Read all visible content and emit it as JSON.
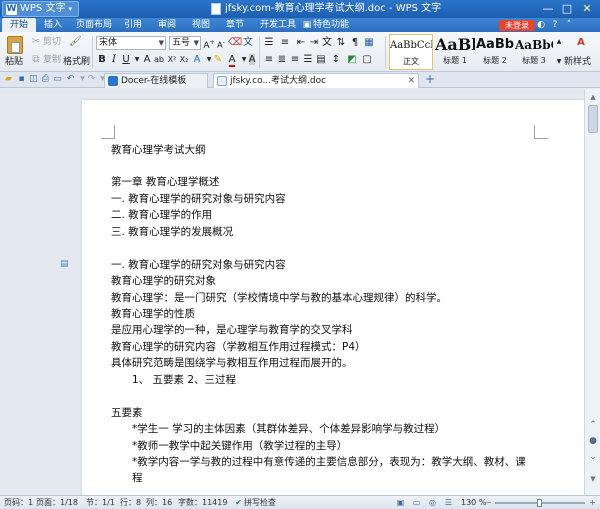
{
  "window": {
    "app_badge": "WPS 文字",
    "title": "jfsky.com-教育心理学考试大纲.doc - WPS 文字",
    "min_icon": "minimize-icon",
    "max_icon": "maximize-icon",
    "close_icon": "close-icon"
  },
  "menu": {
    "items": [
      "开始",
      "插入",
      "页面布局",
      "引用",
      "审阅",
      "视图",
      "章节",
      "开发工具",
      "特色功能"
    ],
    "active_index": 0,
    "login": "未登录"
  },
  "ribbon": {
    "paste": "粘贴",
    "cut": "剪切",
    "copy": "复制",
    "format_painter": "格式刷",
    "font_name": "宋体",
    "font_size": "五号",
    "styles": [
      {
        "sample": "AaBbCcDd",
        "name": "正文"
      },
      {
        "sample": "AaBl",
        "name": "标题 1"
      },
      {
        "sample": "AaBb(",
        "name": "标题 2"
      },
      {
        "sample": "AaBbC",
        "name": "标题 3"
      }
    ],
    "new_style": "新样式"
  },
  "tabs": [
    {
      "label": "Docer-在线模板",
      "active": false
    },
    {
      "label": "jfsky.co...考试大纲.doc",
      "active": true
    }
  ],
  "document": {
    "lines": [
      {
        "text": "教育心理学考试大纲",
        "indent": 0
      },
      {
        "text": "",
        "indent": 0
      },
      {
        "text": "第一章    教育心理学概述",
        "indent": 0
      },
      {
        "text": "一. 教育心理学的研究对象与研究内容",
        "indent": 0
      },
      {
        "text": "二. 教育心理学的作用",
        "indent": 0
      },
      {
        "text": "三. 教育心理学的发展概况",
        "indent": 0
      },
      {
        "text": "",
        "indent": 0
      },
      {
        "text": "一. 教育心理学的研究对象与研究内容",
        "indent": 0
      },
      {
        "text": "教育心理学的研究对象",
        "indent": 0
      },
      {
        "text": "教育心理学：是一门研究（学校情境中学与教的基本心理规律）的科学。",
        "indent": 0
      },
      {
        "text": "教育心理学的性质",
        "indent": 0
      },
      {
        "text": "是应用心理学的一种，是心理学与教育学的交叉学科",
        "indent": 0
      },
      {
        "text": "教育心理学的研究内容（学教相互作用过程模式：P4）",
        "indent": 0
      },
      {
        "text": "具体研究范畴是围绕学与教相互作用过程而展开的。",
        "indent": 0
      },
      {
        "text": "1、 五要素  2、三过程",
        "indent": 1
      },
      {
        "text": "",
        "indent": 0
      },
      {
        "text": "五要素",
        "indent": 0
      },
      {
        "text": "*学生一  学习的主体因素（其群体差异、个体差异影响学与教过程）",
        "indent": 1
      },
      {
        "text": "*教师一教学中起关键作用（教学过程的主导）",
        "indent": 1
      },
      {
        "text": "*教学内容一学与教的过程中有意传递的主要信息部分，表现为：教学大纲、教材、课",
        "indent": 1
      },
      {
        "text": "程",
        "indent": 1
      }
    ]
  },
  "status": {
    "page_num": "页码：1",
    "page": "页面：1/18",
    "section": "节：1/1",
    "row": "行：8",
    "col": "列：16",
    "words": "字数：11419",
    "spell": "拼写检查",
    "zoom": "130 %",
    "zoom_fraction": 0.5
  }
}
